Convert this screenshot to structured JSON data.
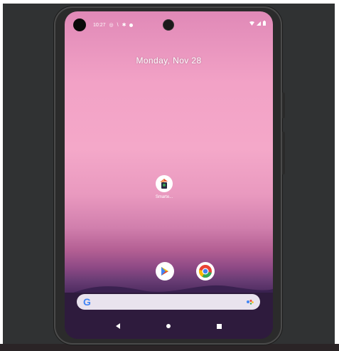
{
  "status_bar": {
    "time": "10:27",
    "notification_icons": [
      "whatsapp-icon",
      "phone-icon",
      "settings-icon",
      "message-icon"
    ],
    "right_icons": [
      "wifi-icon",
      "signal-icon",
      "battery-icon"
    ]
  },
  "home": {
    "date": "Monday, Nov 28"
  },
  "apps": [
    {
      "label": "Smarte...",
      "icon": "app-launcher-icon"
    }
  ],
  "dock": [
    {
      "name": "play-store-icon"
    },
    {
      "name": "chrome-icon"
    }
  ],
  "search": {
    "logo": "G"
  },
  "nav": [
    "back",
    "home",
    "recents"
  ]
}
